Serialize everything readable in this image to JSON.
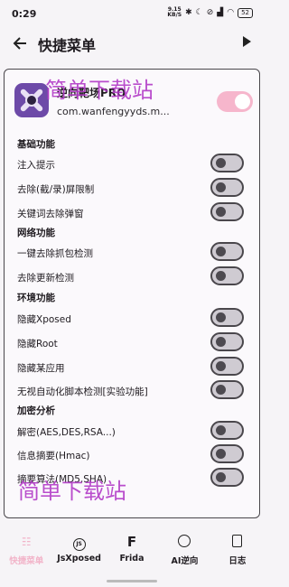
{
  "status": {
    "time": "0:29",
    "speed_value": "9.15",
    "speed_unit": "KB/S",
    "battery": "52"
  },
  "appbar": {
    "title": "快捷菜单"
  },
  "app": {
    "name": "逆向靶场PRO",
    "package": "com.wanfengyyds.m...",
    "enabled": true
  },
  "sections": [
    {
      "title": "基础功能",
      "items": [
        "注入提示",
        "去除(截/录)屏限制",
        "关键词去除弹窗"
      ]
    },
    {
      "title": "网络功能",
      "items": [
        "一键去除抓包检测",
        "去除更新检测"
      ]
    },
    {
      "title": "环境功能",
      "items": [
        "隐藏Xposed",
        "隐藏Root",
        "隐藏某应用",
        "无视自动化脚本检测[实验功能]"
      ]
    },
    {
      "title": "加密分析",
      "items": [
        "解密(AES,DES,RSA...)",
        "信息摘要(Hmac)",
        "摘要算法(MD5,SHA)"
      ]
    }
  ],
  "watermark": [
    "简单下载站",
    "简单下载站"
  ],
  "nav": [
    {
      "label": "快捷菜单",
      "icon": "grid-icon",
      "active": true
    },
    {
      "label": "JsXposed",
      "icon": "js-icon",
      "active": false
    },
    {
      "label": "Frida",
      "icon": "frida-icon",
      "active": false
    },
    {
      "label": "AI逆向",
      "icon": "ai-icon",
      "active": false
    },
    {
      "label": "日志",
      "icon": "log-icon",
      "active": false
    }
  ],
  "colors": {
    "accent": "#f2b4c9",
    "watermark": "#b23bc7",
    "icon_bg": "#6d4aa8"
  }
}
